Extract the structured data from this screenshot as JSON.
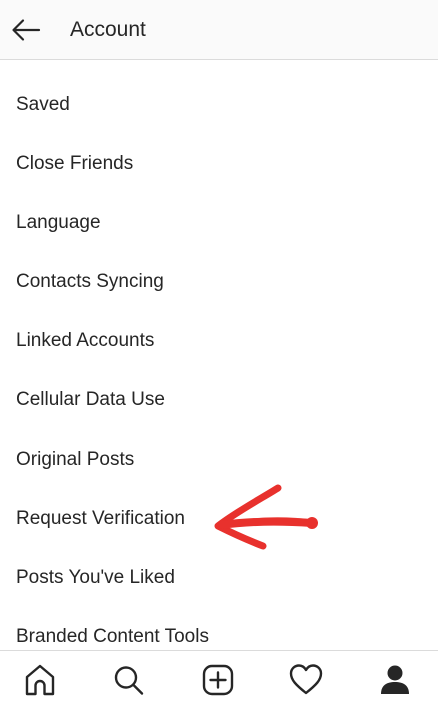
{
  "header": {
    "title": "Account",
    "back_icon": "arrow-left-icon"
  },
  "menu": {
    "items": [
      {
        "label": "Saved"
      },
      {
        "label": "Close Friends"
      },
      {
        "label": "Language"
      },
      {
        "label": "Contacts Syncing"
      },
      {
        "label": "Linked Accounts"
      },
      {
        "label": "Cellular Data Use"
      },
      {
        "label": "Original Posts"
      },
      {
        "label": "Request Verification"
      },
      {
        "label": "Posts You've Liked"
      },
      {
        "label": "Branded Content Tools"
      }
    ]
  },
  "annotation": {
    "type": "hand-drawn-arrow",
    "color": "#e8312d",
    "points_to": "Request Verification"
  },
  "tabbar": {
    "tabs": [
      {
        "icon": "home-icon"
      },
      {
        "icon": "search-icon"
      },
      {
        "icon": "new-post-icon"
      },
      {
        "icon": "heart-icon"
      },
      {
        "icon": "profile-icon",
        "active": true
      }
    ]
  },
  "colors": {
    "text": "#262626",
    "header_bg": "#fafafa",
    "divider": "#dbdbdb",
    "annotation": "#e8312d"
  }
}
